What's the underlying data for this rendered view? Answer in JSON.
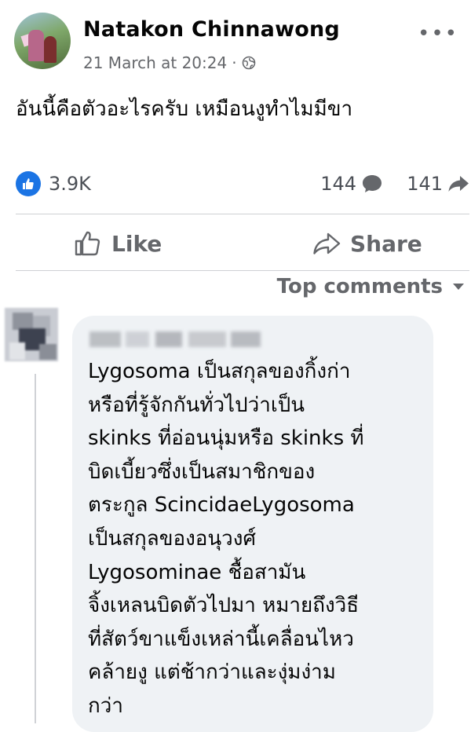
{
  "post": {
    "author": "Natakon Chinnawong",
    "timestamp": "21 March at 20:24",
    "separator": "·",
    "privacy_icon": "globe-icon",
    "more_icon": "•••",
    "text": "อันนี้คือตัวอะไรครับ เหมือนงูทำไมมีขา"
  },
  "stats": {
    "reactions": "3.9K",
    "comments": "144",
    "shares": "141"
  },
  "actions": {
    "like_label": "Like",
    "share_label": "Share"
  },
  "comments": {
    "sort_label": "Top comments",
    "first": {
      "lines": [
        "Lygosoma เป็นสกุลของกิ้งก่า",
        "หรือที่รู้จักกันทั่วไปว่าเป็น",
        "skinks ที่อ่อนนุ่มหรือ skinks ที่",
        "บิดเบี้ยวซึ่งเป็นสมาชิกของ",
        "ตระกูล ScincidaeLygosoma",
        "เป็นสกุลของอนุวงศ์",
        "Lygosominae ชื้อสามัน",
        "จิ้งเหลนบิดตัวไปมา หมายถึงวิธี",
        "ที่สัตว์ขาแข็งเหล่านี้เคลื่อนไหว",
        "คล้ายงู แต่ช้ากว่าและงุ่มง่าม",
        "กว่า"
      ]
    }
  },
  "colors": {
    "accent": "#1b74e4",
    "muted_text": "#65676b",
    "bubble_bg": "#eff2f5"
  }
}
